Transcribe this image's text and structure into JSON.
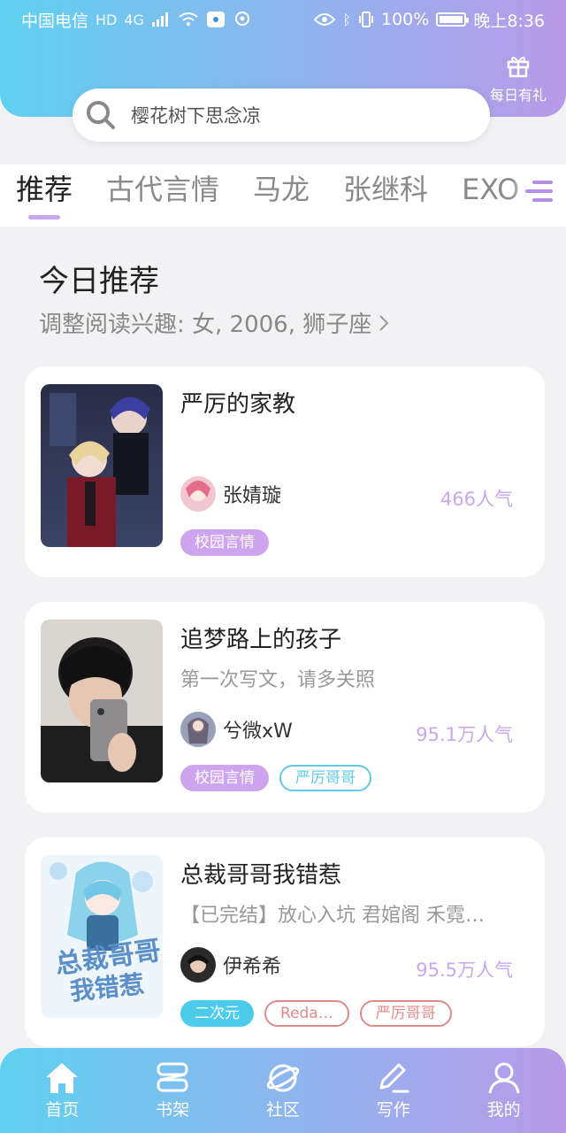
{
  "status_bar": {
    "carrier": "中国电信",
    "network": "4G",
    "battery": "100%",
    "battery_level": 1.0,
    "time": "晚上8:36"
  },
  "header": {
    "search_placeholder": "樱花树下思念凉",
    "gift_label": "每日有礼"
  },
  "tabs": [
    {
      "label": "推荐",
      "active": true
    },
    {
      "label": "古代言情",
      "active": false
    },
    {
      "label": "马龙",
      "active": false
    },
    {
      "label": "张继科",
      "active": false
    },
    {
      "label": "EXO",
      "active": false
    }
  ],
  "section": {
    "title": "今日推荐",
    "interest": "调整阅读兴趣: 女, 2006, 狮子座"
  },
  "books": [
    {
      "title": "严厉的家教",
      "description": "",
      "author": "张婧璇",
      "popularity": "466人气",
      "tags": [
        "校园言情"
      ]
    },
    {
      "title": "追梦路上的孩子",
      "description": "第一次写文，请多关照",
      "author": "兮微xW",
      "popularity": "95.1万人气",
      "tags": [
        "校园言情",
        "严厉哥哥"
      ]
    },
    {
      "title": "总裁哥哥我错惹",
      "description": "【已完结】放心入坑  君婠阁  禾霓…",
      "author": "伊希希",
      "popularity": "95.5万人气",
      "tags": [
        "二次元",
        "Reda…",
        "严厉哥哥"
      ]
    }
  ],
  "bottom_nav": [
    {
      "label": "首页",
      "icon": "home-icon"
    },
    {
      "label": "书架",
      "icon": "bookshelf-icon"
    },
    {
      "label": "社区",
      "icon": "community-icon"
    },
    {
      "label": "写作",
      "icon": "write-icon"
    },
    {
      "label": "我的",
      "icon": "profile-icon"
    }
  ],
  "colors": {
    "gradient_start": "#5fd0f0",
    "gradient_end": "#b89ae8",
    "accent_purple": "#cfa4ee",
    "accent_blue": "#4dcbea",
    "popularity": "#c9a7ec"
  }
}
